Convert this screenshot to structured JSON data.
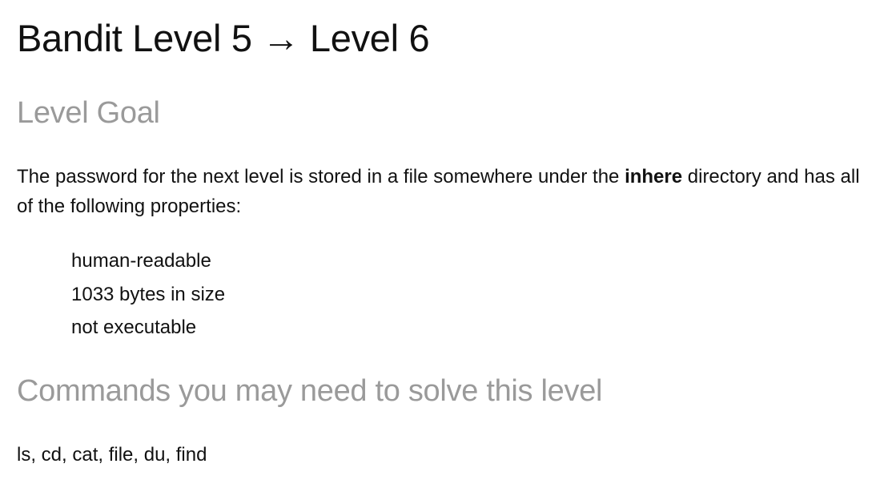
{
  "page": {
    "title": "Bandit Level 5 → Level 6"
  },
  "level_goal": {
    "heading": "Level Goal",
    "text_before": "The password for the next level is stored in a file somewhere under the ",
    "highlight": "inhere",
    "text_after": " directory and has all of the following properties:",
    "properties": [
      "human-readable",
      "1033 bytes in size",
      "not executable"
    ]
  },
  "commands": {
    "heading": "Commands you may need to solve this level",
    "text": "ls, cd, cat, file, du, find"
  }
}
